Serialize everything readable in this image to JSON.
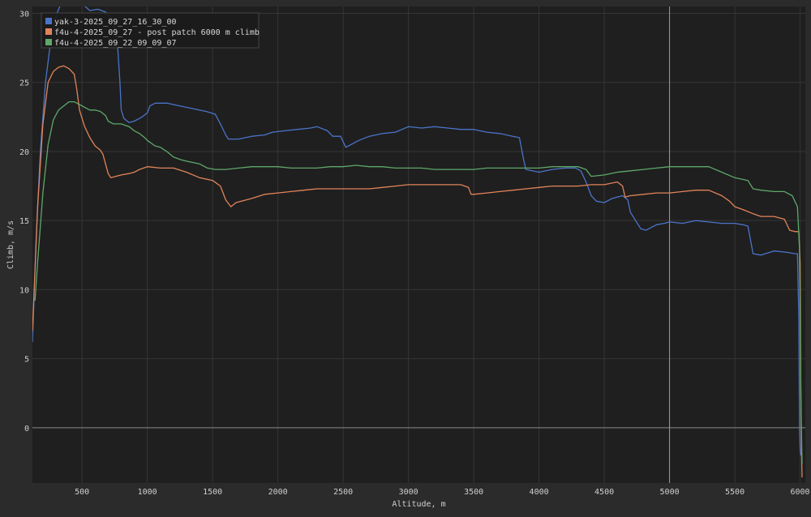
{
  "colors": {
    "background": "#2b2b2b",
    "plot_background": "#1f1f1f",
    "grid": "#363636",
    "axis_text": "#cfcfcf",
    "zero_line": "#8a8a8a"
  },
  "chart_data": {
    "type": "line",
    "xlabel": "Altitude, m",
    "ylabel": "Climb, m/s",
    "xlim": [
      120,
      6040
    ],
    "ylim": [
      -4,
      30.5
    ],
    "x_ticks": [
      500,
      1000,
      1500,
      2000,
      2500,
      3000,
      3500,
      4000,
      4500,
      5000,
      5500,
      6000
    ],
    "y_ticks": [
      0,
      5,
      10,
      15,
      20,
      25,
      30
    ],
    "grid": true,
    "legend_position": "top-left",
    "cursor_line_x": 5000,
    "series": [
      {
        "name": "yak-3-2025_09_27_16_30_00",
        "color": "#4a74c9",
        "points": [
          [
            120,
            6.2
          ],
          [
            150,
            14
          ],
          [
            180,
            20
          ],
          [
            220,
            25
          ],
          [
            260,
            28
          ],
          [
            300,
            29.8
          ],
          [
            350,
            31
          ],
          [
            400,
            32
          ],
          [
            450,
            31.4
          ],
          [
            500,
            30.7
          ],
          [
            560,
            30.2
          ],
          [
            620,
            30.3
          ],
          [
            680,
            30.1
          ],
          [
            740,
            29.5
          ],
          [
            770,
            28
          ],
          [
            790,
            25
          ],
          [
            800,
            23
          ],
          [
            820,
            22.4
          ],
          [
            860,
            22.1
          ],
          [
            900,
            22.2
          ],
          [
            960,
            22.5
          ],
          [
            1000,
            22.8
          ],
          [
            1020,
            23.3
          ],
          [
            1060,
            23.5
          ],
          [
            1150,
            23.5
          ],
          [
            1250,
            23.3
          ],
          [
            1350,
            23.1
          ],
          [
            1450,
            22.9
          ],
          [
            1520,
            22.7
          ],
          [
            1560,
            22.0
          ],
          [
            1600,
            21.2
          ],
          [
            1620,
            20.9
          ],
          [
            1700,
            20.9
          ],
          [
            1800,
            21.1
          ],
          [
            1900,
            21.2
          ],
          [
            1960,
            21.4
          ],
          [
            2050,
            21.5
          ],
          [
            2150,
            21.6
          ],
          [
            2250,
            21.7
          ],
          [
            2300,
            21.8
          ],
          [
            2380,
            21.5
          ],
          [
            2420,
            21.1
          ],
          [
            2480,
            21.1
          ],
          [
            2520,
            20.3
          ],
          [
            2560,
            20.5
          ],
          [
            2620,
            20.8
          ],
          [
            2700,
            21.1
          ],
          [
            2800,
            21.3
          ],
          [
            2900,
            21.4
          ],
          [
            3000,
            21.8
          ],
          [
            3100,
            21.7
          ],
          [
            3200,
            21.8
          ],
          [
            3300,
            21.7
          ],
          [
            3400,
            21.6
          ],
          [
            3500,
            21.6
          ],
          [
            3600,
            21.4
          ],
          [
            3700,
            21.3
          ],
          [
            3800,
            21.1
          ],
          [
            3850,
            21.0
          ],
          [
            3860,
            20.5
          ],
          [
            3880,
            19.5
          ],
          [
            3900,
            18.7
          ],
          [
            4000,
            18.5
          ],
          [
            4100,
            18.7
          ],
          [
            4200,
            18.8
          ],
          [
            4280,
            18.8
          ],
          [
            4320,
            18.6
          ],
          [
            4360,
            17.8
          ],
          [
            4400,
            16.8
          ],
          [
            4440,
            16.4
          ],
          [
            4500,
            16.3
          ],
          [
            4560,
            16.6
          ],
          [
            4640,
            16.8
          ],
          [
            4680,
            16.5
          ],
          [
            4700,
            15.6
          ],
          [
            4740,
            15.0
          ],
          [
            4780,
            14.4
          ],
          [
            4820,
            14.3
          ],
          [
            4860,
            14.5
          ],
          [
            4900,
            14.7
          ],
          [
            4960,
            14.8
          ],
          [
            5000,
            14.9
          ],
          [
            5100,
            14.8
          ],
          [
            5200,
            15.0
          ],
          [
            5300,
            14.9
          ],
          [
            5400,
            14.8
          ],
          [
            5500,
            14.8
          ],
          [
            5560,
            14.7
          ],
          [
            5600,
            14.6
          ],
          [
            5640,
            12.6
          ],
          [
            5700,
            12.5
          ],
          [
            5800,
            12.8
          ],
          [
            5900,
            12.7
          ],
          [
            5960,
            12.6
          ],
          [
            5980,
            12.6
          ],
          [
            5990,
            8
          ],
          [
            5995,
            0
          ],
          [
            6000,
            -1.6
          ],
          [
            6005,
            -2.0
          ]
        ]
      },
      {
        "name": "f4u-4-2025_09_27 - post patch 6000 m climb",
        "color": "#e1845a",
        "points": [
          [
            120,
            7.0
          ],
          [
            160,
            16
          ],
          [
            200,
            22
          ],
          [
            240,
            25
          ],
          [
            280,
            25.8
          ],
          [
            320,
            26.1
          ],
          [
            360,
            26.2
          ],
          [
            400,
            26.0
          ],
          [
            440,
            25.6
          ],
          [
            460,
            24.5
          ],
          [
            480,
            23.0
          ],
          [
            520,
            21.8
          ],
          [
            560,
            21.0
          ],
          [
            600,
            20.4
          ],
          [
            640,
            20.1
          ],
          [
            660,
            19.8
          ],
          [
            700,
            18.4
          ],
          [
            720,
            18.1
          ],
          [
            800,
            18.3
          ],
          [
            860,
            18.4
          ],
          [
            900,
            18.5
          ],
          [
            940,
            18.7
          ],
          [
            1000,
            18.9
          ],
          [
            1100,
            18.8
          ],
          [
            1200,
            18.8
          ],
          [
            1300,
            18.5
          ],
          [
            1400,
            18.1
          ],
          [
            1500,
            17.9
          ],
          [
            1560,
            17.5
          ],
          [
            1600,
            16.5
          ],
          [
            1640,
            16.0
          ],
          [
            1680,
            16.3
          ],
          [
            1800,
            16.6
          ],
          [
            1900,
            16.9
          ],
          [
            2000,
            17.0
          ],
          [
            2100,
            17.1
          ],
          [
            2200,
            17.2
          ],
          [
            2300,
            17.3
          ],
          [
            2400,
            17.3
          ],
          [
            2500,
            17.3
          ],
          [
            2600,
            17.3
          ],
          [
            2700,
            17.3
          ],
          [
            2800,
            17.4
          ],
          [
            2900,
            17.5
          ],
          [
            3000,
            17.6
          ],
          [
            3100,
            17.6
          ],
          [
            3200,
            17.6
          ],
          [
            3300,
            17.6
          ],
          [
            3400,
            17.6
          ],
          [
            3460,
            17.4
          ],
          [
            3480,
            16.9
          ],
          [
            3500,
            16.9
          ],
          [
            3600,
            17.0
          ],
          [
            3700,
            17.1
          ],
          [
            3800,
            17.2
          ],
          [
            3900,
            17.3
          ],
          [
            4000,
            17.4
          ],
          [
            4100,
            17.5
          ],
          [
            4200,
            17.5
          ],
          [
            4300,
            17.5
          ],
          [
            4400,
            17.6
          ],
          [
            4500,
            17.6
          ],
          [
            4600,
            17.8
          ],
          [
            4640,
            17.5
          ],
          [
            4660,
            16.7
          ],
          [
            4700,
            16.8
          ],
          [
            4800,
            16.9
          ],
          [
            4900,
            17.0
          ],
          [
            5000,
            17.0
          ],
          [
            5100,
            17.1
          ],
          [
            5200,
            17.2
          ],
          [
            5300,
            17.2
          ],
          [
            5400,
            16.8
          ],
          [
            5460,
            16.4
          ],
          [
            5500,
            16.0
          ],
          [
            5560,
            15.8
          ],
          [
            5640,
            15.5
          ],
          [
            5700,
            15.3
          ],
          [
            5800,
            15.3
          ],
          [
            5880,
            15.1
          ],
          [
            5920,
            14.3
          ],
          [
            5960,
            14.2
          ],
          [
            5990,
            14.2
          ],
          [
            6000,
            12
          ],
          [
            6005,
            3
          ],
          [
            6010,
            -1.5
          ],
          [
            6015,
            -3.6
          ]
        ]
      },
      {
        "name": "f4u-4-2025_09_22_09_09_07",
        "color": "#5ea86a",
        "points": [
          [
            140,
            9.2
          ],
          [
            160,
            12
          ],
          [
            200,
            17
          ],
          [
            240,
            20.5
          ],
          [
            280,
            22.3
          ],
          [
            320,
            23.0
          ],
          [
            360,
            23.3
          ],
          [
            400,
            23.6
          ],
          [
            440,
            23.6
          ],
          [
            480,
            23.4
          ],
          [
            520,
            23.2
          ],
          [
            560,
            23.0
          ],
          [
            600,
            23.0
          ],
          [
            640,
            22.9
          ],
          [
            680,
            22.6
          ],
          [
            700,
            22.2
          ],
          [
            740,
            22.0
          ],
          [
            800,
            22.0
          ],
          [
            860,
            21.8
          ],
          [
            900,
            21.5
          ],
          [
            940,
            21.3
          ],
          [
            980,
            21.0
          ],
          [
            1000,
            20.8
          ],
          [
            1060,
            20.4
          ],
          [
            1100,
            20.3
          ],
          [
            1150,
            20.0
          ],
          [
            1200,
            19.6
          ],
          [
            1260,
            19.4
          ],
          [
            1300,
            19.3
          ],
          [
            1400,
            19.1
          ],
          [
            1460,
            18.8
          ],
          [
            1520,
            18.7
          ],
          [
            1600,
            18.7
          ],
          [
            1700,
            18.8
          ],
          [
            1800,
            18.9
          ],
          [
            1900,
            18.9
          ],
          [
            2000,
            18.9
          ],
          [
            2100,
            18.8
          ],
          [
            2200,
            18.8
          ],
          [
            2300,
            18.8
          ],
          [
            2400,
            18.9
          ],
          [
            2500,
            18.9
          ],
          [
            2600,
            19.0
          ],
          [
            2700,
            18.9
          ],
          [
            2800,
            18.9
          ],
          [
            2900,
            18.8
          ],
          [
            3000,
            18.8
          ],
          [
            3100,
            18.8
          ],
          [
            3200,
            18.7
          ],
          [
            3300,
            18.7
          ],
          [
            3400,
            18.7
          ],
          [
            3500,
            18.7
          ],
          [
            3600,
            18.8
          ],
          [
            3700,
            18.8
          ],
          [
            3800,
            18.8
          ],
          [
            3900,
            18.8
          ],
          [
            4000,
            18.8
          ],
          [
            4100,
            18.9
          ],
          [
            4200,
            18.9
          ],
          [
            4300,
            18.9
          ],
          [
            4360,
            18.7
          ],
          [
            4400,
            18.2
          ],
          [
            4500,
            18.3
          ],
          [
            4600,
            18.5
          ],
          [
            4700,
            18.6
          ],
          [
            4800,
            18.7
          ],
          [
            4900,
            18.8
          ],
          [
            5000,
            18.9
          ],
          [
            5100,
            18.9
          ],
          [
            5200,
            18.9
          ],
          [
            5300,
            18.9
          ],
          [
            5400,
            18.5
          ],
          [
            5500,
            18.1
          ],
          [
            5600,
            17.9
          ],
          [
            5640,
            17.3
          ],
          [
            5700,
            17.2
          ],
          [
            5800,
            17.1
          ],
          [
            5880,
            17.1
          ],
          [
            5940,
            16.8
          ],
          [
            5960,
            16.4
          ],
          [
            5980,
            16.0
          ],
          [
            5995,
            13
          ],
          [
            6000,
            8
          ],
          [
            6008,
            1
          ],
          [
            6015,
            -2.6
          ]
        ]
      }
    ]
  }
}
